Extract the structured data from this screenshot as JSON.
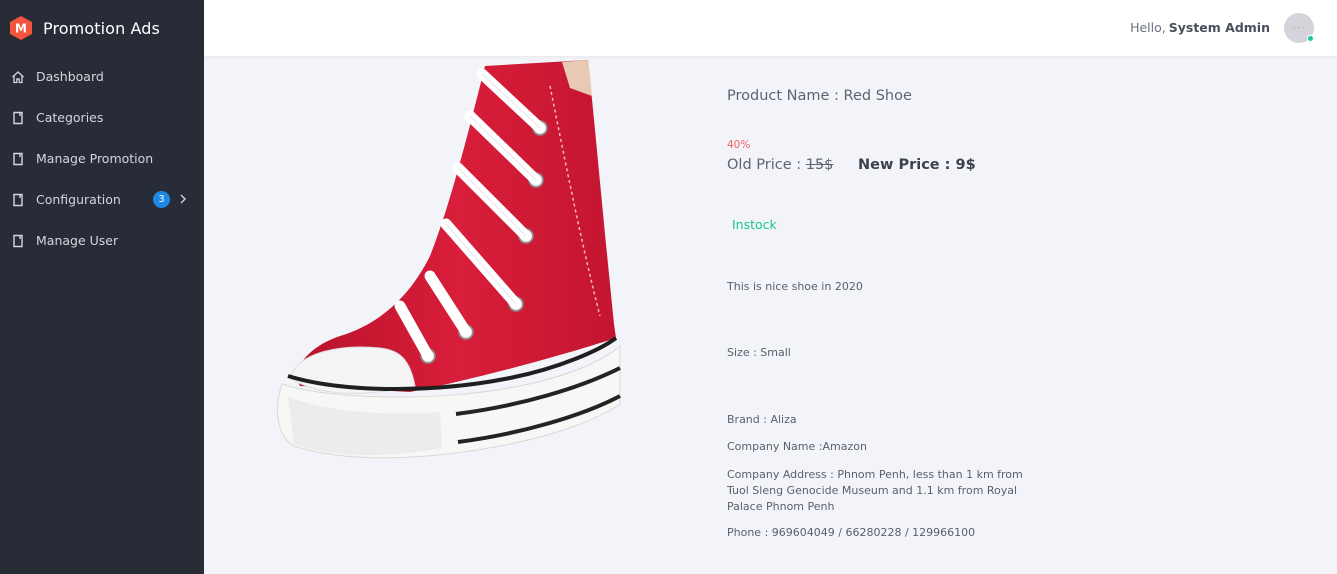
{
  "brand": {
    "name": "Promotion Ads",
    "logo_letter": "M",
    "logo_color": "#f2543d"
  },
  "sidebar": {
    "items": [
      {
        "label": "Dashboard",
        "icon": "home-icon"
      },
      {
        "label": "Categories",
        "icon": "page-icon"
      },
      {
        "label": "Manage Promotion",
        "icon": "page-icon"
      },
      {
        "label": "Configuration",
        "icon": "page-icon",
        "badge": "3"
      },
      {
        "label": "Manage User",
        "icon": "page-icon"
      }
    ]
  },
  "header": {
    "greeting": "Hello,",
    "user_name": "System Admin",
    "status_color": "#1bc5a1"
  },
  "product": {
    "name": "Product Name : Red Shoe",
    "discount": "40%",
    "old_price_label": "Old Price :",
    "old_price": "15$",
    "new_price": "New Price : 9$",
    "stock": "Instock",
    "description": "This is nice shoe in 2020",
    "size": "Size : Small",
    "brand": "Brand : Aliza",
    "company": "Company Name :Amazon",
    "address": "Company Address : Phnom Penh, less than 1 km from Tuol Sleng Genocide Museum and 1.1 km from Royal Palace Phnom Penh",
    "phone": "Phone : 969604049 / 66280228 / 129966100"
  }
}
